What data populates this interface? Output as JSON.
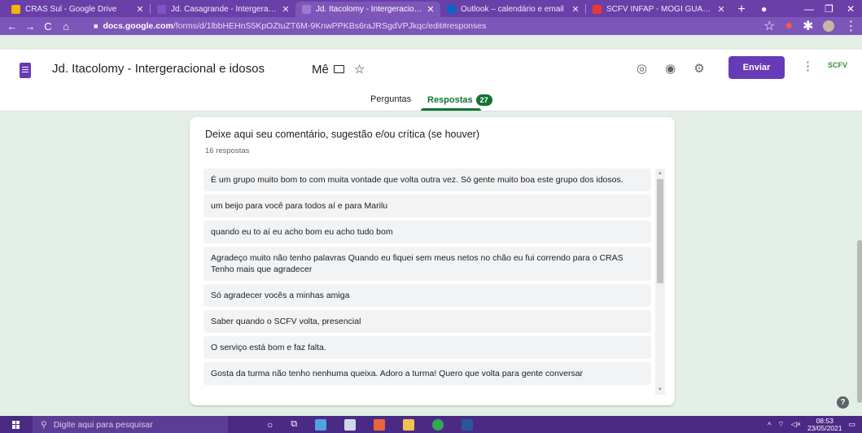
{
  "browser": {
    "tabs": [
      {
        "title": "CRAS Sul - Google Drive",
        "color": "#f4b400",
        "active": false
      },
      {
        "title": "Jd. Casagrande - Intergeracio",
        "color": "#7e57c2",
        "active": false
      },
      {
        "title": "Jd. Itacolomy - Intergeracional",
        "color": "#7e57c2",
        "active": true
      },
      {
        "title": "Outlook – calendário e email",
        "color": "#0a66c2",
        "active": false
      },
      {
        "title": "SCFV INFAP - MOGI GUAÇU",
        "color": "#e53935",
        "active": false
      }
    ],
    "url_host": "docs.google.com",
    "url_path": "/forms/d/1lbbHEHnS5KpOZtuZT6M-9KnwPPKBs6raJRSgdVPJkqc/edit#responses"
  },
  "form": {
    "title": "Jd. Itacolomy - Intergeracional e idosos",
    "folder_label": "Mê",
    "send_label": "Enviar",
    "brand": "SCFV",
    "tabs": {
      "questions": "Perguntas",
      "responses": "Respostas",
      "responses_count": "27"
    }
  },
  "question": {
    "title": "Deixe aqui seu comentário, sugestão e/ou crítica (se houver)",
    "count": "16 respostas",
    "responses": [
      "É um grupo muito bom to com muita vontade que volta outra vez. Só gente muito boa este grupo dos idosos.",
      "um beijo para você para todos aí e para Marilu",
      "quando eu to aí eu acho bom eu acho tudo bom",
      "Agradeço muito não tenho palavras Quando eu fiquei sem meus netos no chão eu fui correndo para o CRAS Tenho mais que agradecer",
      "Só agradecer vocês a minhas amiga",
      "Saber quando o SCFV volta, presencial",
      "O serviço está bom e faz falta.",
      "Gosta da turma não tenho nenhuma queixa. Adoro a turma! Quero que volta para gente conversar"
    ]
  },
  "taskbar": {
    "search_placeholder": "Digite aqui para pesquisar",
    "time": "08:53",
    "date": "23/05/2021"
  }
}
